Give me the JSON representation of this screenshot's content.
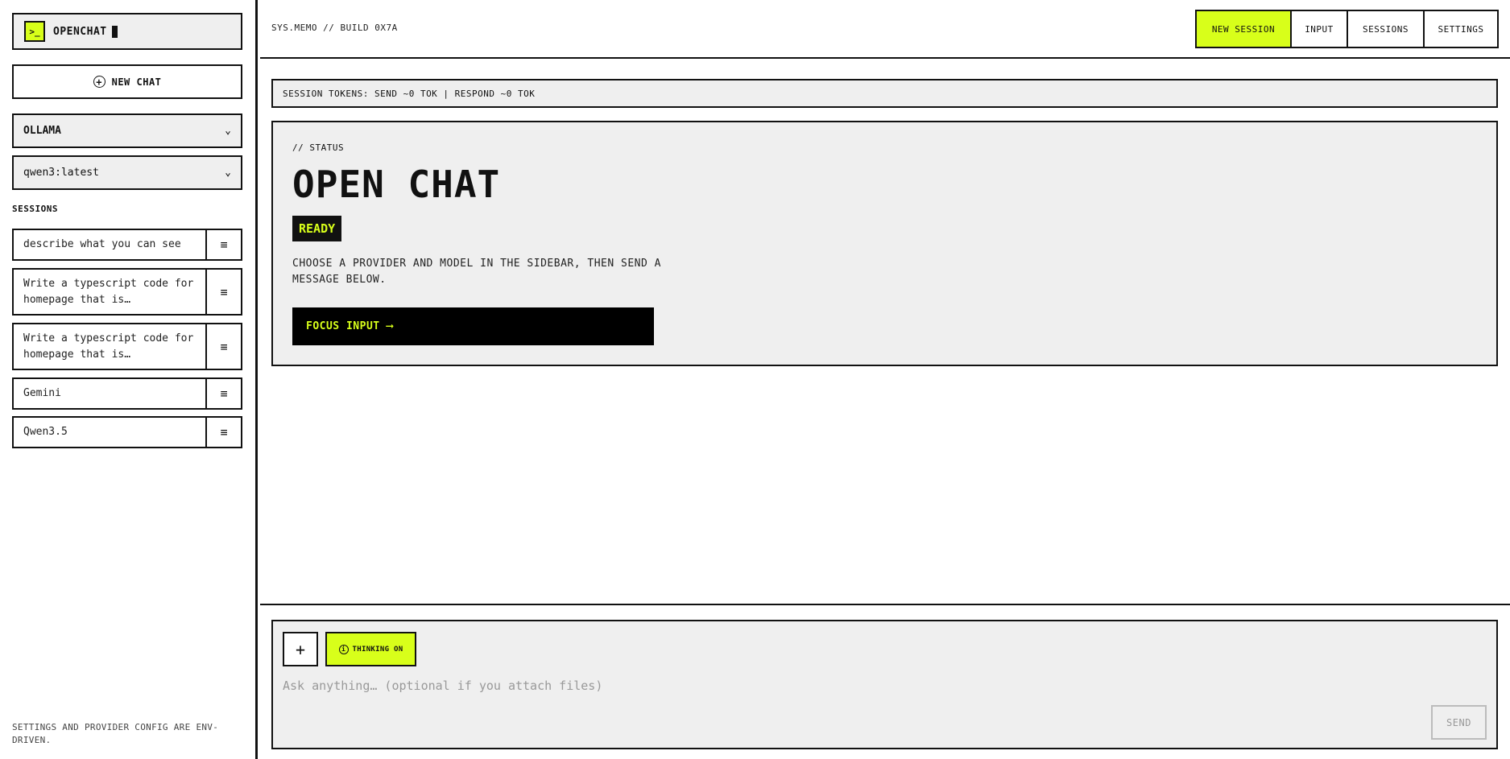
{
  "brand": {
    "icon": ">_",
    "name": "OPENCHAT"
  },
  "sidebar": {
    "new_chat_label": "NEW CHAT",
    "provider": "OLLAMA",
    "model": "qwen3:latest",
    "sessions_label": "SESSIONS",
    "sessions": [
      {
        "title": "describe what you can see"
      },
      {
        "title": "Write a typescript code for homepage that is…"
      },
      {
        "title": "Write a typescript code for homepage that is…"
      },
      {
        "title": "Gemini"
      },
      {
        "title": "Qwen3.5"
      }
    ],
    "footer": "SETTINGS AND PROVIDER CONFIG ARE ENV-DRIVEN."
  },
  "topbar": {
    "sys_label": "SYS.MEMO // BUILD 0X7A",
    "nav": [
      "NEW SESSION",
      "INPUT",
      "SESSIONS",
      "SETTINGS"
    ]
  },
  "tokens": "SESSION TOKENS: SEND ~0 TOK | RESPOND ~0 TOK",
  "status": {
    "tag": "// STATUS",
    "title": "OPEN CHAT",
    "badge": "READY",
    "description": "CHOOSE A PROVIDER AND MODEL IN THE SIDEBAR, THEN SEND A MESSAGE BELOW.",
    "focus_button": "FOCUS INPUT ⟶"
  },
  "composer": {
    "attach_label": "+",
    "thinking_label": "THINKING ON",
    "placeholder": "Ask anything… (optional if you attach files)",
    "send_label": "SEND"
  },
  "colors": {
    "accent": "#d8ff1a",
    "ink": "#111111",
    "panel": "#efefef"
  }
}
